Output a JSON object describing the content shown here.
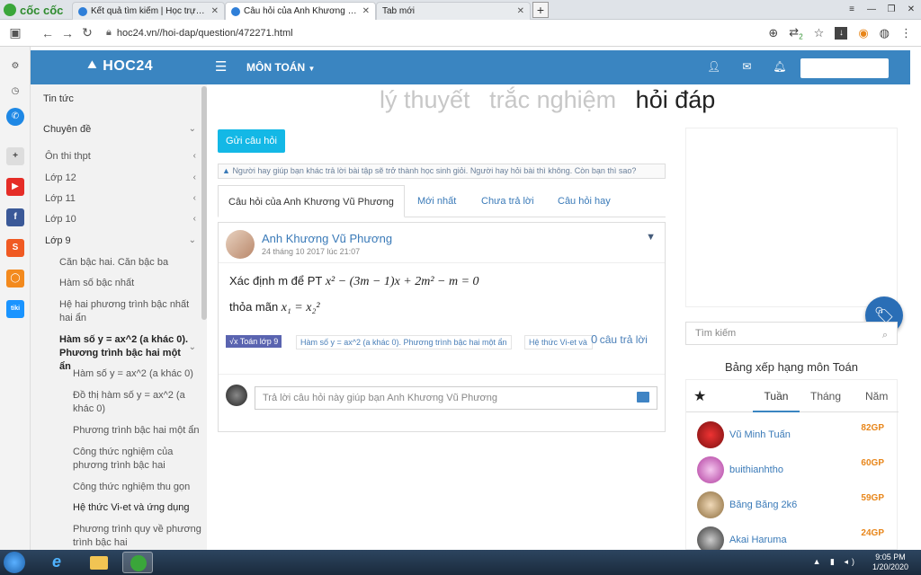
{
  "browser": {
    "brand": "cốc cốc",
    "tabs": [
      {
        "title": "Kết quả tìm kiếm | Học trực tuyến",
        "active": false
      },
      {
        "title": "Câu hỏi của Anh Khương Vũ Phươ",
        "active": true
      },
      {
        "title": "Tab mới",
        "active": false
      }
    ],
    "new_tab": "+",
    "url": "hoc24.vn//hoi-dap/question/472271.html",
    "badge_count": "2"
  },
  "site": {
    "logo": "HOC24",
    "subject_menu": "MÔN TOÁN",
    "colors": {
      "header": "#3a85c1",
      "accent_button": "#13b8e6",
      "link": "#3a7ab8",
      "points": "#e8861a",
      "tag": "#5a64b0"
    }
  },
  "sidebar": {
    "items": [
      {
        "label": "Tin tức",
        "level": 0,
        "chevron": ""
      },
      {
        "label": "Chuyên đề",
        "level": 0,
        "chevron": "⌄"
      },
      {
        "label": "Ôn thi thpt",
        "level": 1,
        "chevron": "‹"
      },
      {
        "label": "Lớp 12",
        "level": 1,
        "chevron": "‹"
      },
      {
        "label": "Lớp 11",
        "level": 1,
        "chevron": "‹"
      },
      {
        "label": "Lớp 10",
        "level": 1,
        "chevron": "‹"
      },
      {
        "label": "Lớp 9",
        "level": 1,
        "chevron": "⌄"
      },
      {
        "label": "Căn bậc hai. Căn bậc ba",
        "level": 2,
        "chevron": ""
      },
      {
        "label": "Hàm số bậc nhất",
        "level": 2,
        "chevron": ""
      },
      {
        "label": "Hệ hai phương trình bậc nhất hai ẩn",
        "level": 2,
        "chevron": ""
      },
      {
        "label": "Hàm số y = ax^2 (a khác 0). Phương trình bậc hai một ẩn",
        "level": 2,
        "chevron": "⌄",
        "bold": true
      },
      {
        "label": "Hàm số y = ax^2 (a khác 0)",
        "level": 3,
        "chevron": ""
      },
      {
        "label": "Đồ thị hàm số y = ax^2 (a khác 0)",
        "level": 3,
        "chevron": ""
      },
      {
        "label": "Phương trình bậc hai một ẩn",
        "level": 3,
        "chevron": ""
      },
      {
        "label": "Công thức nghiệm của phương trình bậc hai",
        "level": 3,
        "chevron": ""
      },
      {
        "label": "Công thức nghiệm thu gọn",
        "level": 3,
        "chevron": ""
      },
      {
        "label": "Hệ thức Vi-et và ứng dụng",
        "level": 3,
        "chevron": "",
        "current": true
      },
      {
        "label": "Phương trình quy về phương trình bậc hai",
        "level": 3,
        "chevron": ""
      }
    ]
  },
  "main": {
    "mode_tabs": [
      "lý thuyết",
      "trắc nghiệm",
      "hỏi đáp"
    ],
    "ask_button": "Gửi câu hỏi",
    "notice": "Người hay giúp bạn khác trả lời bài tập sẽ trở thành học sinh giỏi. Người hay hỏi bài thì không. Còn bạn thì sao?",
    "question_tabs": [
      "Câu hỏi của Anh Khương Vũ Phương",
      "Mới nhất",
      "Chưa trả lời",
      "Câu hỏi hay"
    ],
    "question": {
      "author": "Anh Khương Vũ Phương",
      "date": "24 tháng 10 2017 lúc 21:07",
      "line1_prefix": "Xác định m để PT",
      "line1_math": "x² − (3m − 1)x + 2m² − m = 0",
      "line2_prefix": "thỏa mãn",
      "line2_math": "x₁ = x₂²",
      "topic_tag": "√x Toán lớp 9",
      "tags": [
        "Hàm số y = ax^2 (a khác 0). Phương trình bậc hai một ẩn",
        "Hệ thức Vi-et và ứng dụng"
      ],
      "answer_count": "0",
      "answer_label": "câu trả lời",
      "reply_placeholder": "Trả lời câu hỏi này giúp bạn Anh Khương Vũ Phương"
    }
  },
  "right": {
    "search_placeholder": "Tìm kiếm",
    "ranking_title": "Bảng xếp hạng môn Toán",
    "ranking_tabs": [
      "Tuần",
      "Tháng",
      "Năm"
    ],
    "ranking": [
      {
        "name": "Vũ Minh Tuấn",
        "points": "82GP"
      },
      {
        "name": "buithianhtho",
        "points": "60GP"
      },
      {
        "name": "Băng Băng 2k6",
        "points": "59GP"
      },
      {
        "name": "Akai Haruma",
        "points": "24GP"
      }
    ]
  },
  "taskbar": {
    "time": "9:05 PM",
    "date": "1/20/2020"
  }
}
